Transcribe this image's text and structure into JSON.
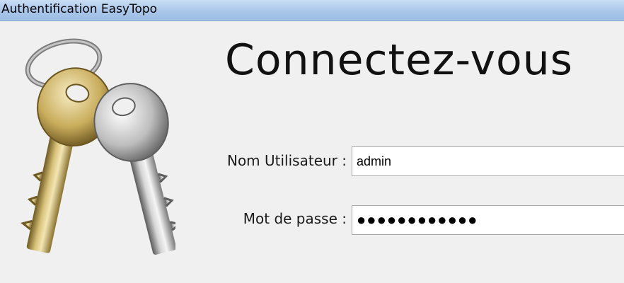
{
  "window": {
    "title": "Authentification EasyTopo"
  },
  "icon": {
    "name": "keys-icon"
  },
  "form": {
    "heading": "Connectez-vous",
    "username_label": "Nom Utilisateur :",
    "username_value": "admin",
    "password_label": "Mot de passe :",
    "password_value": "●●●●●●●●●●●●"
  }
}
